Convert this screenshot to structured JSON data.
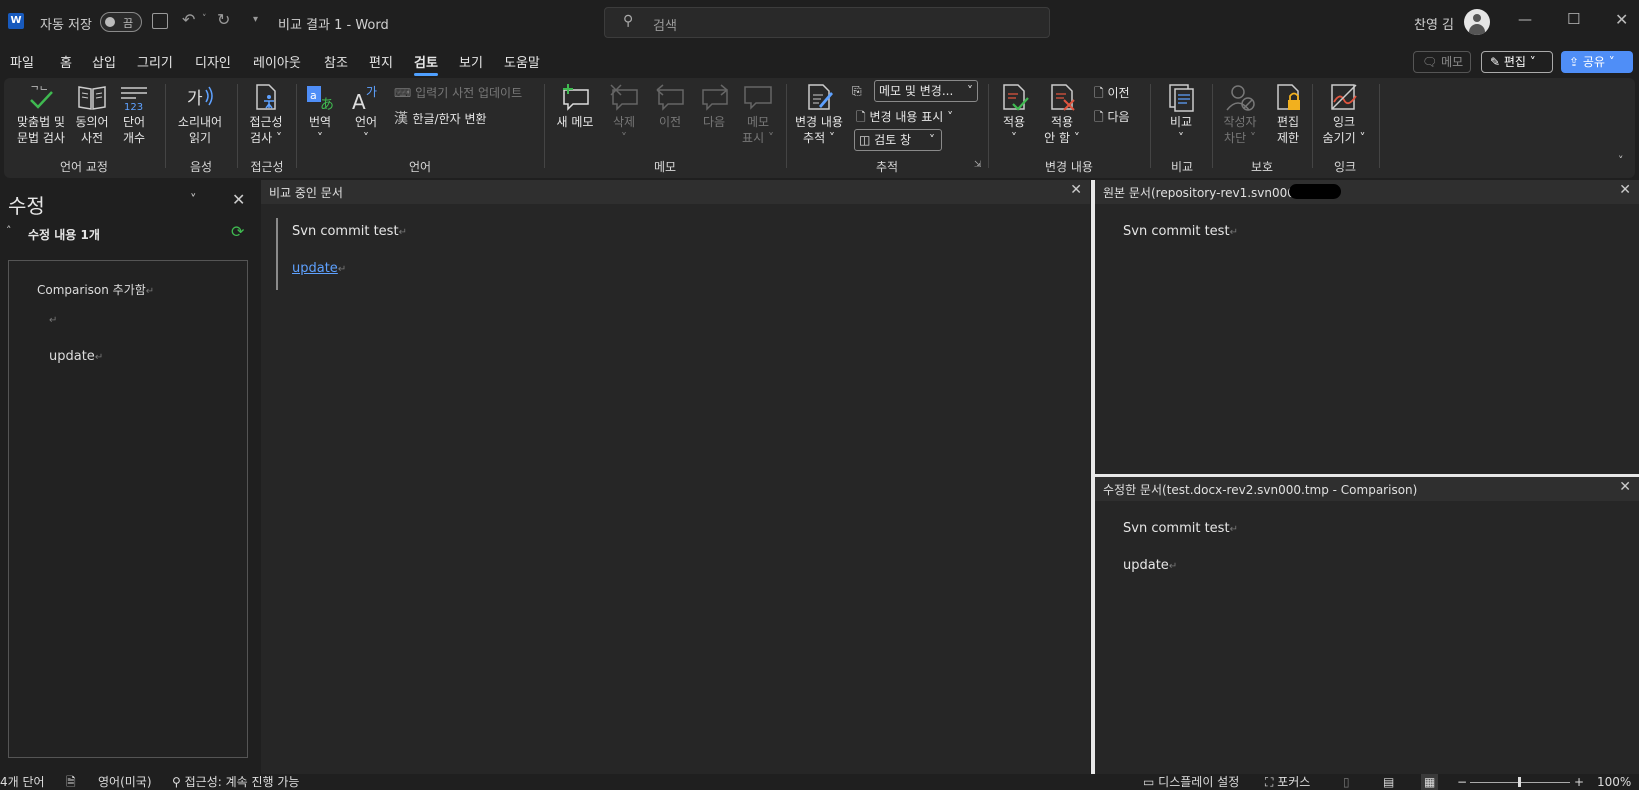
{
  "titlebar": {
    "app_icon": "W",
    "autosave_label": "자동 저장",
    "autosave_state": "끔",
    "doc_title": "비교 결과 1  -  Word",
    "search_placeholder": "검색",
    "user_name": "찬영 김",
    "icons": [
      "word-icon",
      "save-icon",
      "undo-icon",
      "redo-icon",
      "search-icon",
      "avatar",
      "minimize-icon",
      "maximize-icon",
      "close-icon"
    ]
  },
  "menu": {
    "tabs": [
      "파일",
      "홈",
      "삽입",
      "그리기",
      "디자인",
      "레이아웃",
      "참조",
      "편지",
      "검토",
      "보기",
      "도움말"
    ],
    "active": "검토",
    "memo_label": "메모",
    "edit_label": "편집",
    "share_label": "공유"
  },
  "ribbon": {
    "proofing": {
      "group": "언어 교정",
      "spell": "맞춤법 및\n문법 검사",
      "thesaurus": "동의어\n사전",
      "wordcount": "단어\n개수"
    },
    "speech": {
      "group": "음성",
      "read_aloud": "소리내어\n읽기"
    },
    "accessibility": {
      "group": "접근성",
      "check": "접근성\n검사 ˅"
    },
    "language": {
      "group": "언어",
      "translate": "번역\n˅",
      "language": "언어\n˅",
      "ime_update": "입력기 사전 업데이트",
      "hanja": "한글/한자 변환"
    },
    "comments": {
      "group": "메모",
      "new": "새 메모",
      "delete": "삭제\n˅",
      "prev": "이전",
      "next": "다음",
      "show": "메모\n표시 ˅"
    },
    "tracking": {
      "group": "추적",
      "track": "변경 내용\n추적 ˅",
      "markup_select": "메모 및 변경...",
      "show_markup": "변경 내용 표시 ˅",
      "review_pane": "검토 창"
    },
    "changes": {
      "group": "변경 내용",
      "accept": "적용\n˅",
      "reject": "적용\n안 함 ˅",
      "prev": "이전",
      "next": "다음"
    },
    "compare": {
      "group": "비교",
      "compare": "비교\n˅"
    },
    "protect": {
      "group": "보호",
      "block_authors": "작성자\n차단 ˅",
      "restrict": "편집\n제한"
    },
    "ink": {
      "group": "잉크",
      "hide_ink": "잉크\n숨기기 ˅"
    }
  },
  "revision_pane": {
    "title": "수정",
    "count": "수정 내용 1개",
    "author_line": "Comparison  추가함",
    "inserted_text": "update"
  },
  "documents": {
    "compared": {
      "title": "비교 중인 문서",
      "line1": "Svn commit test",
      "line2": "update"
    },
    "original": {
      "title": "원본 문서(repository-rev1.svn000 -",
      "line1": "Svn commit test"
    },
    "revised": {
      "title": "수정한 문서(test.docx-rev2.svn000.tmp - Comparison)",
      "line1": "Svn commit test",
      "line2": "update"
    },
    "paragraph_mark": "↵"
  },
  "statusbar": {
    "words": "4개 단어",
    "language": "영어(미국)",
    "accessibility": "접근성: 계속 진행 가능",
    "display_settings": "디스플레이 설정",
    "focus": "포커스",
    "zoom": "100%",
    "zoom_minus": "−",
    "zoom_plus": "+"
  },
  "colors": {
    "accent": "#4fa0ff",
    "share": "#4f8ef7",
    "insert": "#5ea1ff",
    "green": "#3fb950"
  }
}
